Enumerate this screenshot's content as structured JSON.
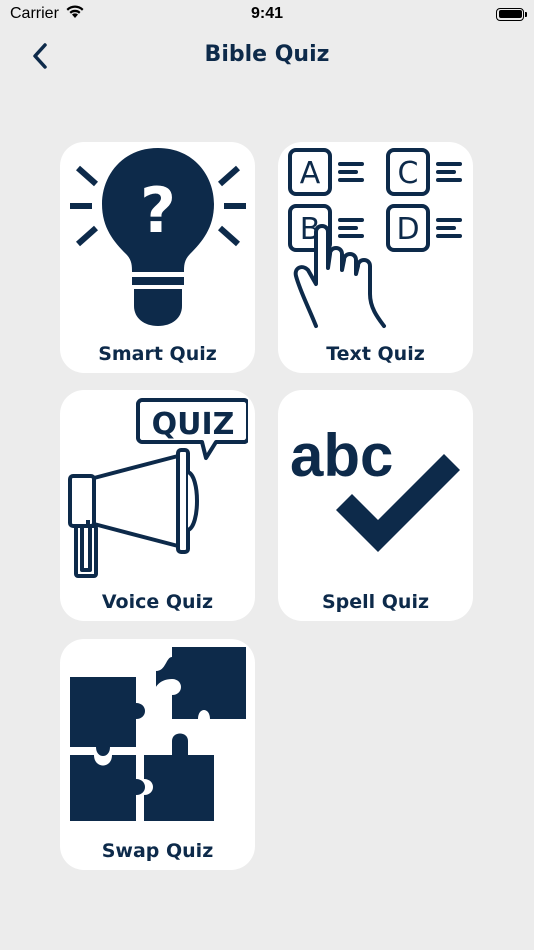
{
  "status_bar": {
    "carrier": "Carrier",
    "time": "9:41",
    "icons": [
      "wifi-icon",
      "battery-icon"
    ]
  },
  "nav": {
    "title": "Bible Quiz",
    "back_icon": "chevron-left-icon"
  },
  "cards": [
    {
      "label": "Smart Quiz",
      "icon": "lightbulb-question-icon"
    },
    {
      "label": "Text Quiz",
      "icon": "abcd-choices-icon"
    },
    {
      "label": "Voice Quiz",
      "icon": "megaphone-quiz-icon"
    },
    {
      "label": "Spell Quiz",
      "icon": "abc-checkmark-icon"
    },
    {
      "label": "Swap Quiz",
      "icon": "puzzle-pieces-icon"
    }
  ],
  "art_text": {
    "a": "A",
    "b": "B",
    "c": "C",
    "d": "D",
    "quiz": "QUIZ",
    "abc": "abc",
    "question": "?"
  },
  "colors": {
    "background": "#ececec",
    "card": "#ffffff",
    "primary": "#0d2a4a"
  }
}
